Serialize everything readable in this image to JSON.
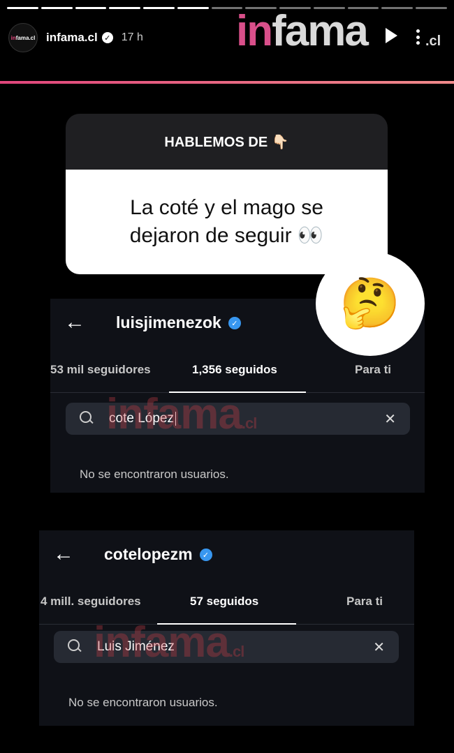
{
  "story": {
    "account": "infama.cl",
    "time": "17 h",
    "avatar_text": "infama.cl",
    "progress_total": 13,
    "progress_done": 6
  },
  "brand": {
    "in": "in",
    "fama": "fama",
    "cl": ".cl"
  },
  "question": {
    "header": "HABLEMOS DE 👇🏻",
    "text": "La coté y el mago se dejaron de seguir 👀"
  },
  "emoji": "🤔",
  "panel1": {
    "username": "luisjimenezok",
    "tabs": [
      "53 mil seguidores",
      "1,356 seguidos",
      "Para ti"
    ],
    "search_value": "cote López",
    "empty_text": "No se encontraron usuarios.",
    "watermark": "infama",
    "watermark_cl": ".cl"
  },
  "panel2": {
    "username": "cotelopezm",
    "tabs": [
      "4 mill. seguidores",
      "57 seguidos",
      "Para ti"
    ],
    "search_value": "Luis Jiménez",
    "empty_text": "No se encontraron usuarios.",
    "watermark": "infama",
    "watermark_cl": ".cl"
  },
  "icons": {
    "back": "back-arrow-icon",
    "search": "search-icon",
    "clear": "close-icon",
    "verified": "verified-badge-icon",
    "play": "play-icon",
    "more": "more-options-icon"
  },
  "colors": {
    "brand_pink": "#e0457b",
    "verified_blue": "#3897f0",
    "panel_bg": "#0f1117",
    "search_bg": "#262a33"
  }
}
